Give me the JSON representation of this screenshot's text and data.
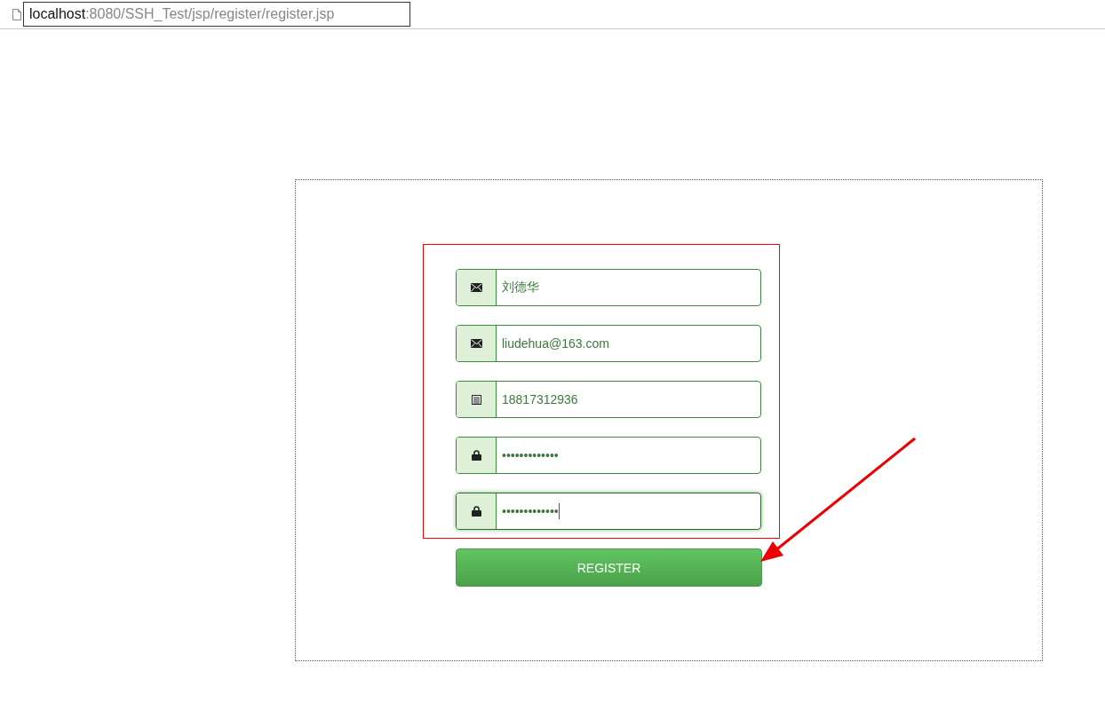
{
  "address_bar": {
    "host": "localhost",
    "path": ":8080/SSH_Test/jsp/register/register.jsp"
  },
  "fields": [
    {
      "kind": "name",
      "value": "刘德华",
      "focused": false
    },
    {
      "kind": "email",
      "value": "liudehua@163.com",
      "focused": false
    },
    {
      "kind": "phone",
      "value": "18817312936",
      "focused": false
    },
    {
      "kind": "password",
      "value": "•••••••••••••",
      "focused": false
    },
    {
      "kind": "password",
      "value": "•••••••••••••",
      "focused": true
    }
  ],
  "button": {
    "label": "REGISTER"
  }
}
